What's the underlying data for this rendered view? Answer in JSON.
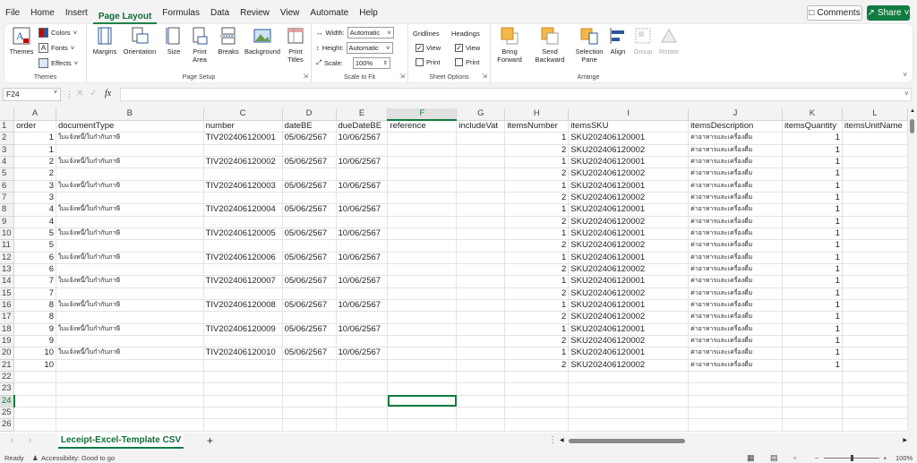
{
  "menu": {
    "items": [
      "File",
      "Home",
      "Insert",
      "Page Layout",
      "Formulas",
      "Data",
      "Review",
      "View",
      "Automate",
      "Help"
    ],
    "active": "Page Layout",
    "comments_label": "Comments",
    "share_label": "Share"
  },
  "ribbon": {
    "themes": {
      "themes_label": "Themes",
      "colors_label": "Colors",
      "fonts_label": "Fonts",
      "effects_label": "Effects",
      "group_label": "Themes"
    },
    "page_setup": {
      "margins_label": "Margins",
      "orientation_label": "Orientation",
      "size_label": "Size",
      "print_area_label": "Print Area",
      "breaks_label": "Breaks",
      "background_label": "Background",
      "print_titles_label": "Print Titles",
      "group_label": "Page Setup"
    },
    "scale_to_fit": {
      "width_label": "Width:",
      "width_value": "Automatic",
      "height_label": "Height:",
      "height_value": "Automatic",
      "scale_label": "Scale:",
      "scale_value": "100%",
      "group_label": "Scale to Fit"
    },
    "sheet_options": {
      "gridlines_label": "Gridlines",
      "headings_label": "Headings",
      "view_label": "View",
      "print_label": "Print",
      "group_label": "Sheet Options"
    },
    "arrange": {
      "bring_forward_label": "Bring Forward",
      "send_backward_label": "Send Backward",
      "selection_pane_label": "Selection Pane",
      "align_label": "Align",
      "group_label": "Group",
      "rotate_label": "Rotate",
      "arrange_label": "Arrange"
    }
  },
  "formula_bar": {
    "name_box": "F24",
    "fx": "fx",
    "content": ""
  },
  "grid": {
    "columns": [
      "A",
      "B",
      "C",
      "D",
      "E",
      "F",
      "G",
      "H",
      "I",
      "J",
      "K",
      "L"
    ],
    "selected_column": "F",
    "selected_row": 24,
    "header_row": [
      "order",
      "documentType",
      "number",
      "dateBE",
      "dueDateBE",
      "reference",
      "includeVat",
      "itemsNumber",
      "itemsSKU",
      "itemsDescription",
      "itemsQuantity",
      "itemsUnitName"
    ],
    "rows": [
      [
        "1",
        "ใบแจ้งหนี้/ใบกำกับภาษี",
        "TIV202406120001",
        "05/06/2567",
        "10/06/2567",
        "",
        "",
        "1",
        "SKU202406120001",
        "ค่าอาหารและเครื่องดื่ม",
        "1",
        ""
      ],
      [
        "1",
        "",
        "",
        "",
        "",
        "",
        "",
        "2",
        "SKU202406120002",
        "ค่าอาหารและเครื่องดื่ม",
        "1",
        ""
      ],
      [
        "2",
        "ใบแจ้งหนี้/ใบกำกับภาษี",
        "TIV202406120002",
        "05/06/2567",
        "10/06/2567",
        "",
        "",
        "1",
        "SKU202406120001",
        "ค่าอาหารและเครื่องดื่ม",
        "1",
        ""
      ],
      [
        "2",
        "",
        "",
        "",
        "",
        "",
        "",
        "2",
        "SKU202406120002",
        "ค่าอาหารและเครื่องดื่ม",
        "1",
        ""
      ],
      [
        "3",
        "ใบแจ้งหนี้/ใบกำกับภาษี",
        "TIV202406120003",
        "05/06/2567",
        "10/06/2567",
        "",
        "",
        "1",
        "SKU202406120001",
        "ค่าอาหารและเครื่องดื่ม",
        "1",
        ""
      ],
      [
        "3",
        "",
        "",
        "",
        "",
        "",
        "",
        "2",
        "SKU202406120002",
        "ค่าอาหารและเครื่องดื่ม",
        "1",
        ""
      ],
      [
        "4",
        "ใบแจ้งหนี้/ใบกำกับภาษี",
        "TIV202406120004",
        "05/06/2567",
        "10/06/2567",
        "",
        "",
        "1",
        "SKU202406120001",
        "ค่าอาหารและเครื่องดื่ม",
        "1",
        ""
      ],
      [
        "4",
        "",
        "",
        "",
        "",
        "",
        "",
        "2",
        "SKU202406120002",
        "ค่าอาหารและเครื่องดื่ม",
        "1",
        ""
      ],
      [
        "5",
        "ใบแจ้งหนี้/ใบกำกับภาษี",
        "TIV202406120005",
        "05/06/2567",
        "10/06/2567",
        "",
        "",
        "1",
        "SKU202406120001",
        "ค่าอาหารและเครื่องดื่ม",
        "1",
        ""
      ],
      [
        "5",
        "",
        "",
        "",
        "",
        "",
        "",
        "2",
        "SKU202406120002",
        "ค่าอาหารและเครื่องดื่ม",
        "1",
        ""
      ],
      [
        "6",
        "ใบแจ้งหนี้/ใบกำกับภาษี",
        "TIV202406120006",
        "05/06/2567",
        "10/06/2567",
        "",
        "",
        "1",
        "SKU202406120001",
        "ค่าอาหารและเครื่องดื่ม",
        "1",
        ""
      ],
      [
        "6",
        "",
        "",
        "",
        "",
        "",
        "",
        "2",
        "SKU202406120002",
        "ค่าอาหารและเครื่องดื่ม",
        "1",
        ""
      ],
      [
        "7",
        "ใบแจ้งหนี้/ใบกำกับภาษี",
        "TIV202406120007",
        "05/06/2567",
        "10/06/2567",
        "",
        "",
        "1",
        "SKU202406120001",
        "ค่าอาหารและเครื่องดื่ม",
        "1",
        ""
      ],
      [
        "7",
        "",
        "",
        "",
        "",
        "",
        "",
        "2",
        "SKU202406120002",
        "ค่าอาหารและเครื่องดื่ม",
        "1",
        ""
      ],
      [
        "8",
        "ใบแจ้งหนี้/ใบกำกับภาษี",
        "TIV202406120008",
        "05/06/2567",
        "10/06/2567",
        "",
        "",
        "1",
        "SKU202406120001",
        "ค่าอาหารและเครื่องดื่ม",
        "1",
        ""
      ],
      [
        "8",
        "",
        "",
        "",
        "",
        "",
        "",
        "2",
        "SKU202406120002",
        "ค่าอาหารและเครื่องดื่ม",
        "1",
        ""
      ],
      [
        "9",
        "ใบแจ้งหนี้/ใบกำกับภาษี",
        "TIV202406120009",
        "05/06/2567",
        "10/06/2567",
        "",
        "",
        "1",
        "SKU202406120001",
        "ค่าอาหารและเครื่องดื่ม",
        "1",
        ""
      ],
      [
        "9",
        "",
        "",
        "",
        "",
        "",
        "",
        "2",
        "SKU202406120002",
        "ค่าอาหารและเครื่องดื่ม",
        "1",
        ""
      ],
      [
        "10",
        "ใบแจ้งหนี้/ใบกำกับภาษี",
        "TIV202406120010",
        "05/06/2567",
        "10/06/2567",
        "",
        "",
        "1",
        "SKU202406120001",
        "ค่าอาหารและเครื่องดื่ม",
        "1",
        ""
      ],
      [
        "10",
        "",
        "",
        "",
        "",
        "",
        "",
        "2",
        "SKU202406120002",
        "ค่าอาหารและเครื่องดื่ม",
        "1",
        ""
      ]
    ],
    "row_numbers": [
      1,
      2,
      3,
      4,
      5,
      6,
      7,
      8,
      9,
      10,
      11,
      12,
      13,
      14,
      15,
      16,
      17,
      18,
      19,
      20,
      21,
      22,
      23,
      24,
      25,
      26
    ]
  },
  "sheet_tabs": {
    "active_tab": "Leceipt-Excel-Template CSV",
    "add_label": "+"
  },
  "status": {
    "ready": "Ready",
    "accessibility": "Accessibility: Good to go",
    "zoom": "100%"
  },
  "colors": {
    "accent": "#107c41",
    "selected_header": "#e1e1e1"
  }
}
